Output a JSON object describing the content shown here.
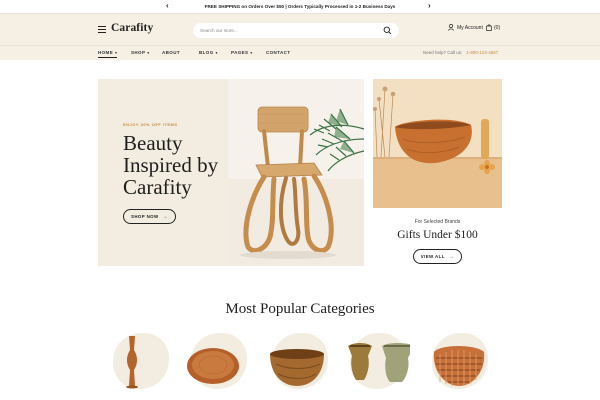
{
  "announcement": {
    "text": "FREE SHIPPING on Orders Over $50 | Orders Typically Processed in 1-2 Business Days",
    "prev_icon": "chevron-left-icon",
    "next_icon": "chevron-right-icon"
  },
  "header": {
    "logo": "Carafity",
    "search_placeholder": "Search our store...",
    "account_label": "My Account",
    "cart_count": "(0)"
  },
  "nav": {
    "items": [
      {
        "label": "HOME",
        "dropdown": true
      },
      {
        "label": "SHOP",
        "dropdown": true
      },
      {
        "label": "ABOUT",
        "dropdown": false
      },
      {
        "label": "BLOG",
        "dropdown": true
      },
      {
        "label": "PAGES",
        "dropdown": true
      },
      {
        "label": "CONTACT",
        "dropdown": false
      }
    ],
    "active": "HOME",
    "help_text": "Need help? Call us:",
    "help_phone": "1-800-123-4567"
  },
  "hero": {
    "eyebrow": "ENJOY 30% OFF ITEMS",
    "title_line1": "Beauty",
    "title_line2": "Inspired by",
    "title_line3": "Carafity",
    "button": "SHOP NOW"
  },
  "promo": {
    "subtitle": "For Selected Brands",
    "title": "Gifts Under $100",
    "button": "VIEW ALL"
  },
  "categories": {
    "title": "Most Popular Categories"
  },
  "colors": {
    "accent": "#c98a3d",
    "header_bg": "#f5efe4",
    "panel_bg": "#f3ece0",
    "wood": "#b8642e"
  }
}
